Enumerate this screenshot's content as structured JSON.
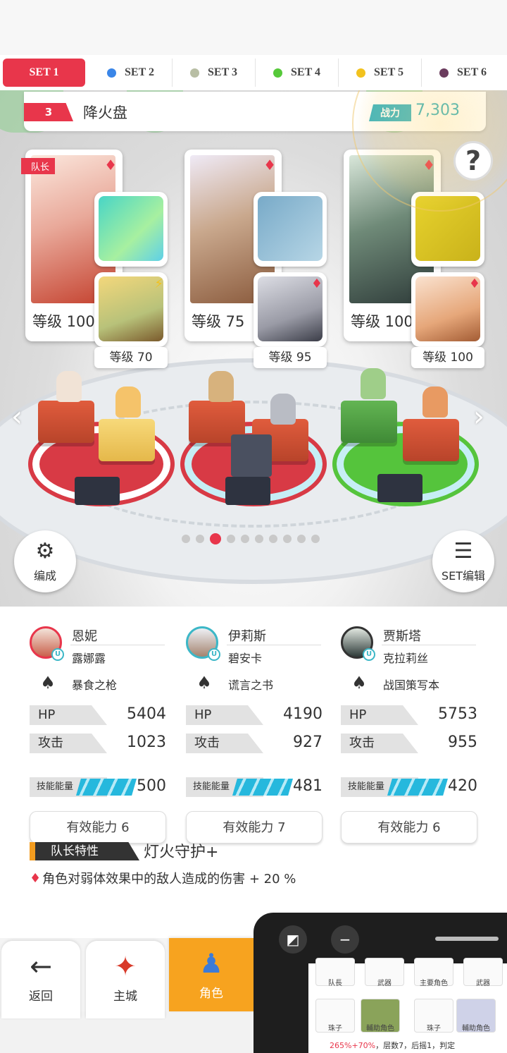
{
  "tabs": [
    {
      "label": "SET 1",
      "color": "#e8364b"
    },
    {
      "label": "SET 2",
      "color": "#3a86e8"
    },
    {
      "label": "SET 3",
      "color": "#b8bea4"
    },
    {
      "label": "SET 4",
      "color": "#56c93a"
    },
    {
      "label": "SET 5",
      "color": "#f2c21e"
    },
    {
      "label": "SET 6",
      "color": "#6b3c5e"
    }
  ],
  "team": {
    "number": "3",
    "name": "降火盘",
    "power_label": "战力",
    "power_value": "7,303"
  },
  "captain_label": "队长",
  "heroes": [
    {
      "level": "等级 100",
      "sub_level": "等级 70"
    },
    {
      "level": "等级 75",
      "sub_level": "等级 95"
    },
    {
      "level": "等级 100",
      "sub_level": "等级 100"
    }
  ],
  "controls": {
    "formation_label": "编成",
    "set_edit_label": "SET编辑",
    "page_dots": 10,
    "active_dot": 2
  },
  "members": [
    {
      "hero": "恩妮",
      "sub": "露娜露",
      "weapon": "暴食之枪",
      "hp_label": "HP",
      "hp": "5404",
      "atk_label": "攻击",
      "atk": "1023",
      "skill_label": "技能能量",
      "skill": "500",
      "ability": "有效能力 6"
    },
    {
      "hero": "伊莉斯",
      "sub": "碧安卡",
      "weapon": "谎言之书",
      "hp_label": "HP",
      "hp": "4190",
      "atk_label": "攻击",
      "atk": "927",
      "skill_label": "技能能量",
      "skill": "481",
      "ability": "有效能力 7"
    },
    {
      "hero": "贾斯塔",
      "sub": "克拉莉丝",
      "weapon": "战国策写本",
      "hp_label": "HP",
      "hp": "5753",
      "atk_label": "攻击",
      "atk": "955",
      "skill_label": "技能能量",
      "skill": "420",
      "ability": "有效能力 6"
    }
  ],
  "leader": {
    "label": "队长特性",
    "value": "灯火守护+",
    "effect": "角色对弱体效果中的敌人造成的伤害 + 20 %"
  },
  "nav": {
    "back": "返回",
    "city": "主城",
    "character": "角色"
  },
  "overlay": {
    "cells": [
      "队長",
      "武器",
      "主要角色",
      "武器",
      "珠子",
      "輔助角色",
      "珠子",
      "輔助角色"
    ],
    "text_red": "265%+70%",
    "text_rest": "，层数7，后摇1，判定"
  }
}
